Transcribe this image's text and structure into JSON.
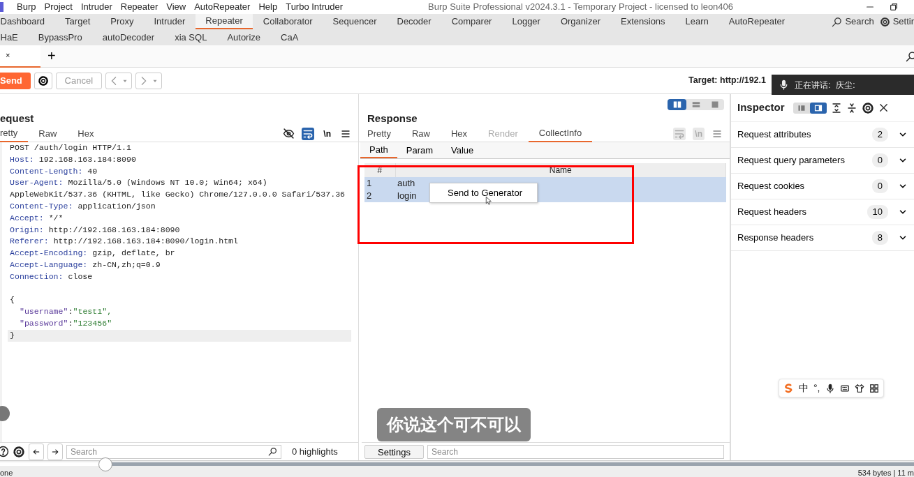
{
  "menu_bar": {
    "items": [
      "Burp",
      "Project",
      "Intruder",
      "Repeater",
      "View",
      "AutoRepeater",
      "Help",
      "Turbo Intruder"
    ],
    "title": "Burp Suite Professional v2024.3.1 - Temporary Project - licensed to leon406"
  },
  "main_tabs": {
    "rows": [
      {
        "tabs": [
          {
            "label": "Dashboard",
            "selected": false
          },
          {
            "label": "Target",
            "selected": false
          },
          {
            "label": "Proxy",
            "selected": false
          },
          {
            "label": "Intruder",
            "selected": false
          },
          {
            "label": "Repeater",
            "selected": true
          },
          {
            "label": "Collaborator",
            "selected": false
          },
          {
            "label": "Sequencer",
            "selected": false
          },
          {
            "label": "Decoder",
            "selected": false
          },
          {
            "label": "Comparer",
            "selected": false
          },
          {
            "label": "Logger",
            "selected": false
          },
          {
            "label": "Organizer",
            "selected": false
          },
          {
            "label": "Extensions",
            "selected": false
          },
          {
            "label": "Learn",
            "selected": false
          },
          {
            "label": "AutoRepeater",
            "selected": false
          }
        ]
      },
      {
        "tabs": [
          {
            "label": "HaE",
            "selected": false
          },
          {
            "label": "BypassPro",
            "selected": false
          },
          {
            "label": "autoDecoder",
            "selected": false
          },
          {
            "label": "xia SQL",
            "selected": false
          },
          {
            "label": "Autorize",
            "selected": false
          },
          {
            "label": "CaA",
            "selected": false
          }
        ]
      }
    ],
    "tools": [
      {
        "kind": "search",
        "label": "Search"
      },
      {
        "kind": "settings",
        "label": "Settir"
      }
    ]
  },
  "repeater_tabs": {
    "tabs": [
      {
        "close": "×",
        "selected": true
      }
    ],
    "add": "+"
  },
  "toolbar": {
    "send": "Send",
    "cancel": {
      "label": "Cancel",
      "disabled": true
    },
    "target": "Target: http://192.1"
  },
  "request": {
    "title": "equest",
    "tabs": [
      {
        "label": "retty",
        "selected": true
      },
      {
        "label": "Raw",
        "selected": false
      },
      {
        "label": "Hex",
        "selected": false
      }
    ],
    "wrap_selected": true,
    "tools_disabled": false,
    "newline_button": "\\n",
    "lines": [
      {
        "kind": "start",
        "text": "POST /auth/login HTTP/1.1",
        "current": false
      },
      {
        "kind": "header",
        "name": "Host:",
        "value": "192.168.163.184:8090",
        "current": false
      },
      {
        "kind": "header",
        "name": "Content-Length:",
        "value": "40",
        "current": false
      },
      {
        "kind": "header",
        "name": "User-Agent:",
        "value": "Mozilla/5.0 (Windows NT 10.0; Win64; x64)",
        "current": false
      },
      {
        "kind": "cont",
        "text": "AppleWebKit/537.36 (KHTML, like Gecko) Chrome/127.0.0.0 Safari/537.36",
        "current": false
      },
      {
        "kind": "header",
        "name": "Content-Type:",
        "value": "application/json",
        "current": false
      },
      {
        "kind": "header",
        "name": "Accept:",
        "value": "*/*",
        "current": false
      },
      {
        "kind": "header",
        "name": "Origin:",
        "value": "http://192.168.163.184:8090",
        "current": false
      },
      {
        "kind": "header",
        "name": "Referer:",
        "value": "http://192.168.163.184:8090/login.html",
        "current": false
      },
      {
        "kind": "header",
        "name": "Accept-Encoding:",
        "value": "gzip, deflate, br",
        "current": false
      },
      {
        "kind": "header",
        "name": "Accept-Language:",
        "value": "zh-CN,zh;q=0.9",
        "current": false
      },
      {
        "kind": "header",
        "name": "Connection:",
        "value": "close",
        "current": false
      },
      {
        "kind": "blank",
        "current": false
      },
      {
        "kind": "brace",
        "text": "{",
        "current": false
      },
      {
        "kind": "json",
        "key": "\"username\"",
        "sep": ":",
        "value": "\"test1\",",
        "current": false
      },
      {
        "kind": "json",
        "key": "\"password\"",
        "sep": ":",
        "value": "\"123456\"",
        "current": false
      },
      {
        "kind": "brace",
        "text": "}",
        "current": true
      }
    ],
    "search": {
      "placeholder": "Search"
    },
    "highlights": "0 highlights"
  },
  "layout_modes": [
    {
      "kind": "columns",
      "selected": true
    },
    {
      "kind": "rows",
      "selected": false
    },
    {
      "kind": "single",
      "selected": false
    }
  ],
  "response": {
    "title": "Response",
    "tabs": [
      {
        "label": "Pretty",
        "selected": false,
        "disabled": false
      },
      {
        "label": "Raw",
        "selected": false,
        "disabled": false
      },
      {
        "label": "Hex",
        "selected": false,
        "disabled": false
      },
      {
        "label": "Render",
        "selected": false,
        "disabled": true
      },
      {
        "label": "CollectInfo",
        "selected": true,
        "disabled": false
      }
    ],
    "wrap_selected": false,
    "tools_disabled": true,
    "newline_button": "\\n",
    "sub_tabs": [
      {
        "label": "Path",
        "selected": true
      },
      {
        "label": "Param",
        "selected": false
      },
      {
        "label": "Value",
        "selected": false
      }
    ],
    "table": {
      "columns": [
        "#",
        "Name"
      ],
      "rows": [
        {
          "cells": [
            "1",
            "auth"
          ],
          "selected": true
        },
        {
          "cells": [
            "2",
            "login"
          ],
          "selected": true
        }
      ]
    },
    "context_menu": {
      "items": [
        "Send to Generator"
      ]
    },
    "settings": "Settings",
    "search": {
      "placeholder": "Search"
    }
  },
  "inspector": {
    "title": "Inspector",
    "view_modes": [
      {
        "kind": "stacked",
        "selected": false
      },
      {
        "kind": "side",
        "selected": true
      }
    ],
    "sections": [
      {
        "label": "Request attributes",
        "count": "2"
      },
      {
        "label": "Request query parameters",
        "count": "0"
      },
      {
        "label": "Request cookies",
        "count": "0"
      },
      {
        "label": "Request headers",
        "count": "10"
      },
      {
        "label": "Response headers",
        "count": "8"
      }
    ]
  },
  "status_bar": {
    "left": "one",
    "right": "534 bytes | 11 m"
  },
  "video_overlay": {
    "speaking": {
      "label": "正在讲话:",
      "speaker": "庆尘:"
    },
    "subtitle": "你说这个可不可以",
    "progress": {
      "level": 0.115
    }
  },
  "ime_toolbar": {
    "items": [
      "中",
      "°,"
    ]
  }
}
